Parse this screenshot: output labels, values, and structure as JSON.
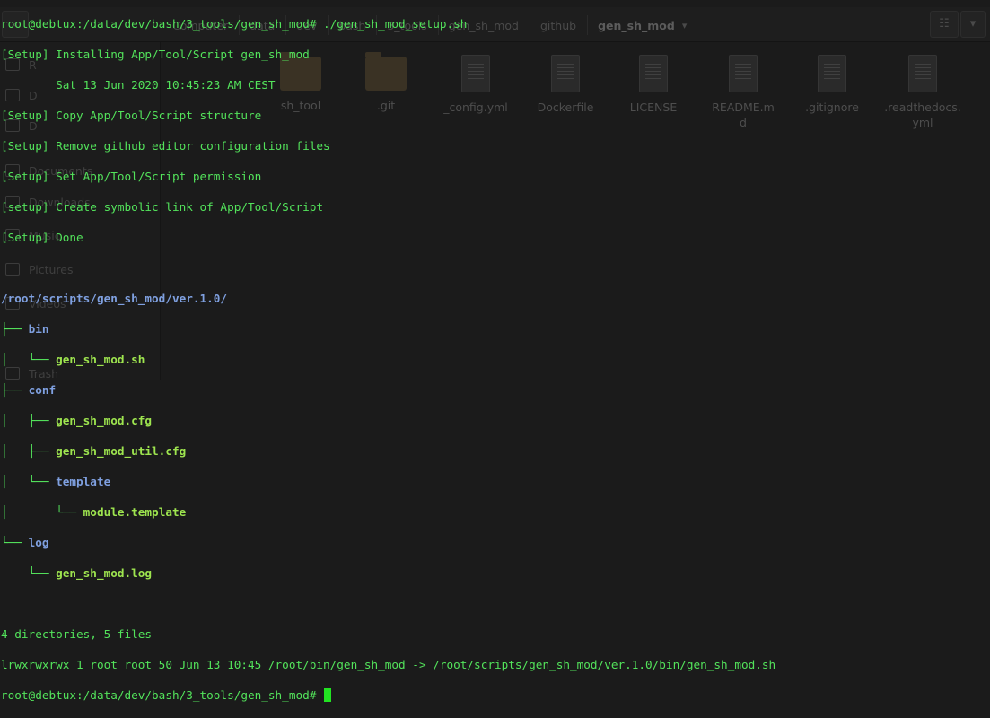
{
  "file_manager": {
    "breadcrumbs": [
      "Computer",
      "data",
      "dev",
      "bash",
      "3_tools",
      "gen_sh_mod",
      "github"
    ],
    "current_folder": "gen_sh_mod",
    "sidebar": [
      "R",
      "D",
      "D",
      "Documents",
      "Downloads",
      "Music",
      "Pictures",
      "Videos",
      "Trash"
    ],
    "files": [
      {
        "name": "sh_tool",
        "kind": "folder"
      },
      {
        "name": ".git",
        "kind": "folder"
      },
      {
        "name": "_config.yml",
        "kind": "doc"
      },
      {
        "name": "Dockerfile",
        "kind": "doc"
      },
      {
        "name": "LICENSE",
        "kind": "doc"
      },
      {
        "name": "README.md",
        "kind": "doc"
      },
      {
        "name": ".gitignore",
        "kind": "doc"
      },
      {
        "name": ".readthedocs.yml",
        "kind": "doc"
      }
    ]
  },
  "terminal": {
    "prompt_cmd": "root@debtux:/data/dev/bash/3_tools/gen_sh_mod# ./gen_sh_mod_setup.sh",
    "setup": [
      "[Setup] Installing App/Tool/Script gen_sh_mod",
      "        Sat 13 Jun 2020 10:45:23 AM CEST",
      "[Setup] Copy App/Tool/Script structure",
      "[Setup] Remove github editor configuration files",
      "[Setup] Set App/Tool/Script permission",
      "[setup] Create symbolic link of App/Tool/Script",
      "[Setup] Done"
    ],
    "tree_root": "/root/scripts/gen_sh_mod/ver.1.0/",
    "tree": {
      "bin": "bin",
      "bin_file": "gen_sh_mod.sh",
      "conf": "conf",
      "conf_file1": "gen_sh_mod.cfg",
      "conf_file2": "gen_sh_mod_util.cfg",
      "template": "template",
      "template_file": "module.template",
      "log": "log",
      "log_file": "gen_sh_mod.log"
    },
    "summary": "4 directories, 5 files",
    "symlink": "lrwxrwxrwx 1 root root 50 Jun 13 10:45 /root/bin/gen_sh_mod -> /root/scripts/gen_sh_mod/ver.1.0/bin/gen_sh_mod.sh",
    "prompt": "root@debtux:/data/dev/bash/3_tools/gen_sh_mod# "
  },
  "colors": {
    "text": "#53e35b",
    "directory": "#7fa0e0",
    "file": "#9ee54f",
    "background": "#1b1b1b"
  }
}
